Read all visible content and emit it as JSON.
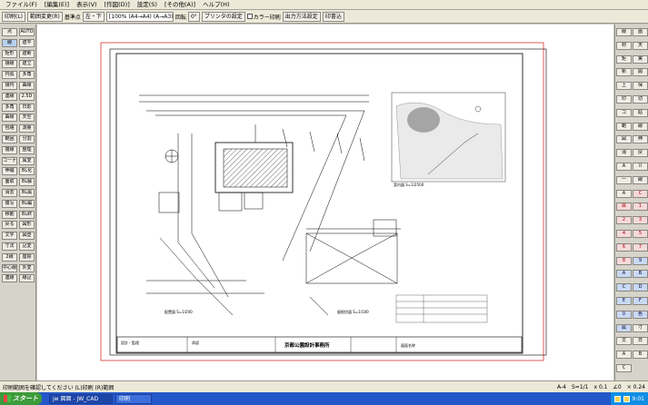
{
  "menubar": {
    "items": [
      "ファイル(F)",
      "[編集(E)]",
      "表示(V)",
      "[作図(D)]",
      "設定(S)",
      "[その他(A)]",
      "ヘルプ(H)"
    ]
  },
  "toolbar": {
    "print_button": "印刷(L)",
    "range_button": "範囲変更(R)",
    "reference_label": "基準点",
    "reference_value": "左・下",
    "paper_select": "[100% (A4→A4) (A→A3)]",
    "rotation_label": "回転",
    "rotation_value": "0°",
    "printer_settings": "プリンタの設定",
    "color_print_label": "カラー印刷",
    "output_method": "出力方法設定",
    "batch": "印書込"
  },
  "left_tools": [
    "点",
    "線",
    "矩形",
    "接線",
    "円弧",
    "接円",
    "連線",
    "多角",
    "曲線",
    "包絡",
    "範囲",
    "複線",
    "コーナー",
    "伸縮",
    "面取",
    "消去",
    "複写",
    "移動",
    "戻る",
    "文字",
    "寸法",
    "2線",
    "中心線",
    "連線",
    "AUTO",
    "建平",
    "建断",
    "建立",
    "多角",
    "曲線",
    "2.5D",
    "日影",
    "天空",
    "測量",
    "分割",
    "整理",
    "属変",
    "BL化",
    "BL解",
    "BL属",
    "BL編",
    "BL終",
    "図形",
    "図登",
    "記変",
    "座標",
    "外変",
    "線記"
  ],
  "right_tools": [
    "線",
    "画",
    "材",
    "天",
    "矩",
    "実",
    "新",
    "開",
    "上",
    "保",
    "印",
    "切",
    "コ",
    "貼",
    "範",
    "線",
    "図",
    "伸",
    "消",
    "戻",
    "A",
    "ll",
    "一",
    "線",
    "A",
    "C",
    "目",
    "1",
    "2",
    "3",
    "4",
    "5",
    "6",
    "7",
    "8",
    "9",
    "A",
    "B",
    "C",
    "D",
    "E",
    "F",
    "0",
    "色",
    "属",
    "寸",
    "文",
    "日",
    "A",
    "B",
    "C"
  ],
  "drawing": {
    "title_block_company": "京都公園設計事務所",
    "title_block_label_1": "設計・監理",
    "title_block_label_2": "承認",
    "title_block_label_3": "図面名称",
    "location_map_label": "案内図 S=1/2500",
    "plan_label": "配置図 S=1/200",
    "roof_label": "屋根伏図 S=1/100"
  },
  "status": {
    "message": "印刷範囲を確認してください (L)印刷 (R)範囲",
    "scale": "A-4",
    "snap": "S=1/1",
    "zoom": "x 0.1",
    "angle": "∠0",
    "layer": "× 0.24"
  },
  "taskbar": {
    "start_label": "スタート",
    "tasks": [
      "jw 図面 - JW_CAD",
      "印刷"
    ],
    "time": "9:01"
  },
  "colors": {
    "titlebar_blue": "#2457c8",
    "start_green": "#3c9b3a",
    "frame_red": "#d33"
  }
}
